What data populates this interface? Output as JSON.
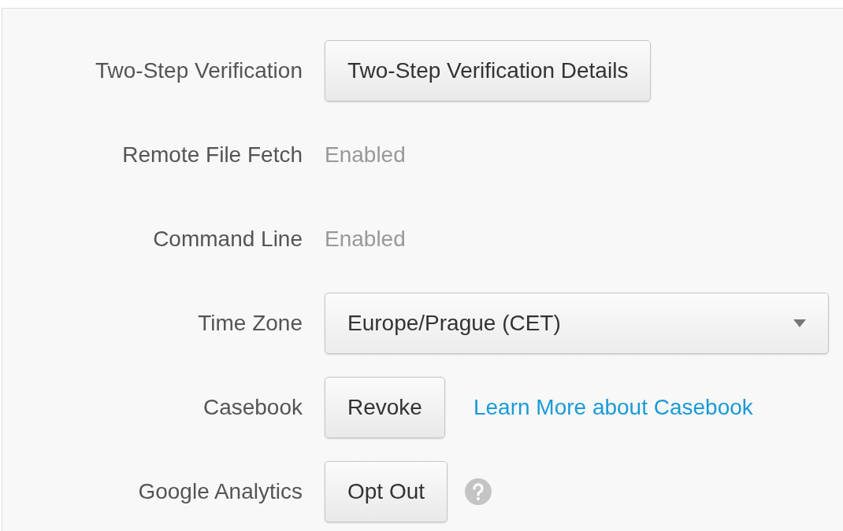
{
  "rows": [
    {
      "label": "Two-Step Verification",
      "kind": "button",
      "button": "Two-Step Verification Details"
    },
    {
      "label": "Remote File Fetch",
      "kind": "status",
      "value": "Enabled"
    },
    {
      "label": "Command Line",
      "kind": "status",
      "value": "Enabled"
    },
    {
      "label": "Time Zone",
      "kind": "select",
      "value": "Europe/Prague (CET)"
    },
    {
      "label": "Casebook",
      "kind": "button",
      "button": "Revoke",
      "link": "Learn More about Casebook"
    },
    {
      "label": "Google Analytics",
      "kind": "button",
      "button": "Opt Out",
      "help": true
    }
  ]
}
